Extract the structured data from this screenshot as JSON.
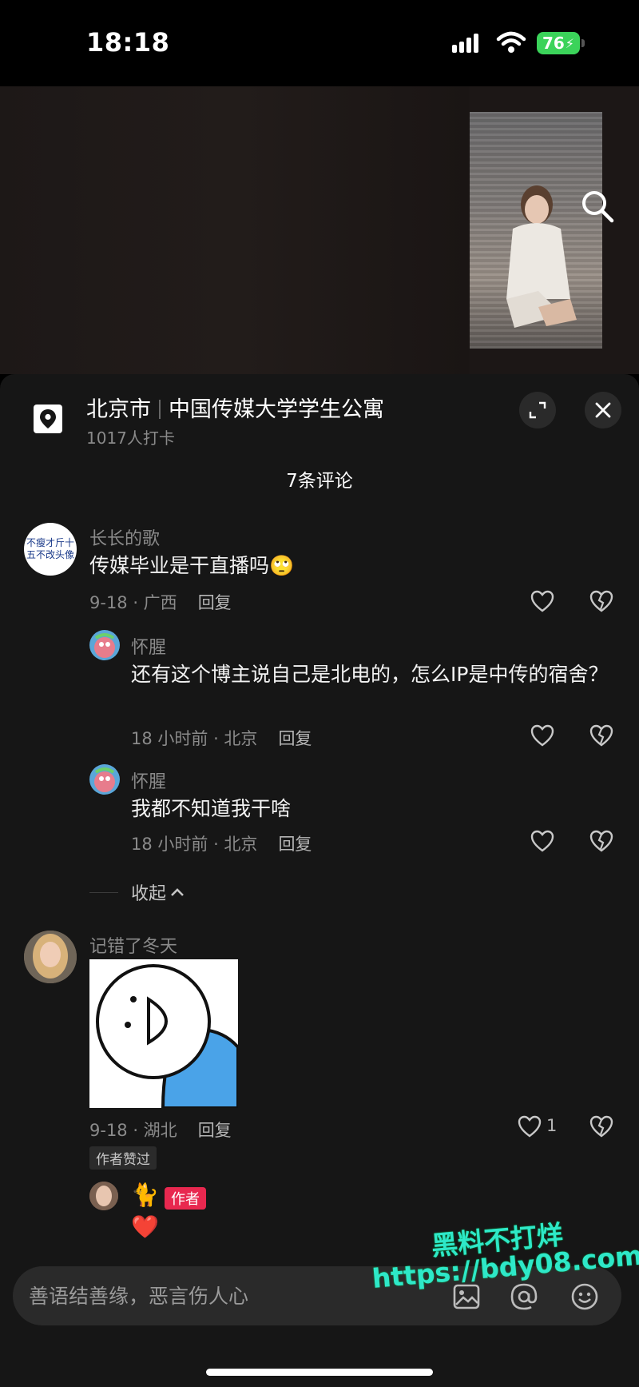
{
  "status_bar": {
    "time": "18:18",
    "battery": "76"
  },
  "location": {
    "city": "北京市",
    "place": "中国传媒大学学生公寓",
    "checkins": "1017人打卡"
  },
  "comments_header": "7条评论",
  "comments": [
    {
      "user": "长长的歌",
      "avatar_text": "不瘦才斤十五不改头像",
      "text": "传媒毕业是干直播吗🙄",
      "date_region": "9-18 · 广西",
      "reply_label": "回复"
    },
    {
      "user": "怀腥",
      "text": "还有这个博主说自己是北电的，怎么IP是中传的宿舍？",
      "date_region": "18 小时前 · 北京",
      "reply_label": "回复"
    },
    {
      "user": "怀腥",
      "text": "我都不知道我干啥",
      "date_region": "18 小时前 · 北京",
      "reply_label": "回复"
    },
    {
      "user": "记错了冬天",
      "date_region": "9-18 · 湖北",
      "reply_label": "回复",
      "likes": "1",
      "author_liked": "作者赞过"
    }
  ],
  "collapse_label": "收起",
  "author_reply": {
    "emoji": "🐈",
    "tag": "作者",
    "text": "❤️"
  },
  "input": {
    "placeholder": "善语结善缘，恶言伤人心"
  },
  "watermark": {
    "line1": "黑料不打烊",
    "line2": "https://bdy08.com"
  },
  "colors": {
    "accent_red": "#e8284f",
    "battery_green": "#3bd35a",
    "watermark": "#2ee8c8",
    "sheet_bg": "#161616"
  }
}
